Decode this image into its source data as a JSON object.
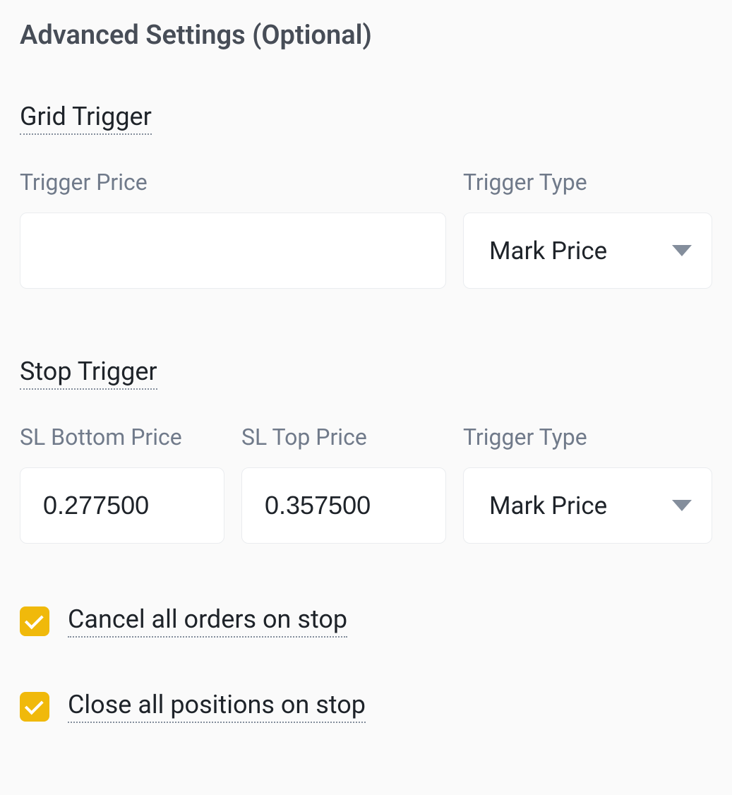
{
  "heading": "Advanced Settings (Optional)",
  "grid_trigger": {
    "title": "Grid Trigger",
    "trigger_price": {
      "label": "Trigger Price",
      "value": ""
    },
    "trigger_type": {
      "label": "Trigger Type",
      "selected": "Mark Price"
    }
  },
  "stop_trigger": {
    "title": "Stop Trigger",
    "sl_bottom": {
      "label": "SL Bottom Price",
      "value": "0.277500"
    },
    "sl_top": {
      "label": "SL Top Price",
      "value": "0.357500"
    },
    "trigger_type": {
      "label": "Trigger Type",
      "selected": "Mark Price"
    }
  },
  "options": {
    "cancel_orders": {
      "label": "Cancel all orders on stop",
      "checked": true
    },
    "close_positions": {
      "label": "Close all positions on stop",
      "checked": true
    }
  }
}
